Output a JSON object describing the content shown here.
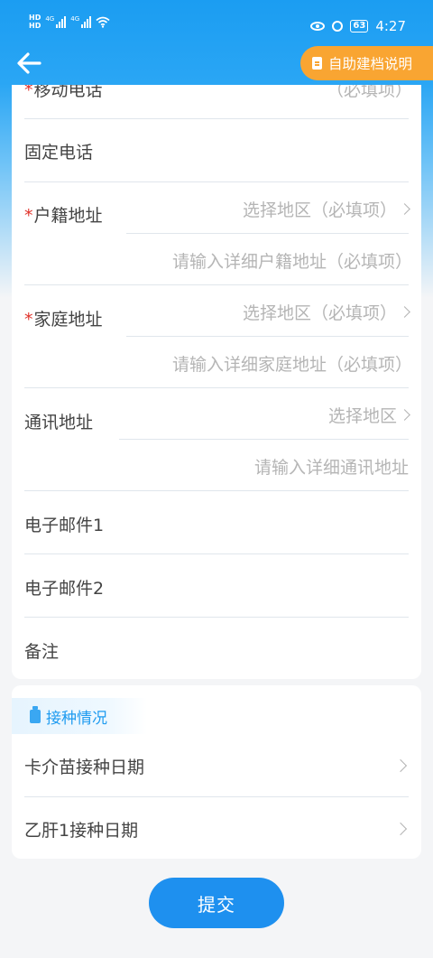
{
  "status_bar": {
    "network_left": "4G",
    "network_right": "4G",
    "battery": "63",
    "time": "4:27"
  },
  "header": {
    "help_label": "自助建档说明"
  },
  "form": {
    "mobile_label": "移动电话",
    "mobile_placeholder": "（必填项）",
    "landline_label": "固定电话",
    "household_label": "户籍地址",
    "household_region_placeholder": "选择地区（必填项）",
    "household_detail_placeholder": "请输入详细户籍地址（必填项）",
    "home_label": "家庭地址",
    "home_region_placeholder": "选择地区（必填项）",
    "home_detail_placeholder": "请输入详细家庭地址（必填项）",
    "mail_label": "通讯地址",
    "mail_region_placeholder": "选择地区",
    "mail_detail_placeholder": "请输入详细通讯地址",
    "email1_label": "电子邮件1",
    "email2_label": "电子邮件2",
    "notes_label": "备注"
  },
  "vaccination": {
    "section_title": "接种情况",
    "bcg_label": "卡介苗接种日期",
    "hepb_label": "乙肝1接种日期"
  },
  "actions": {
    "submit_label": "提交"
  },
  "colors": {
    "primary": "#1e90ef",
    "help_button": "#f9a532",
    "required_star": "#e0322a"
  }
}
